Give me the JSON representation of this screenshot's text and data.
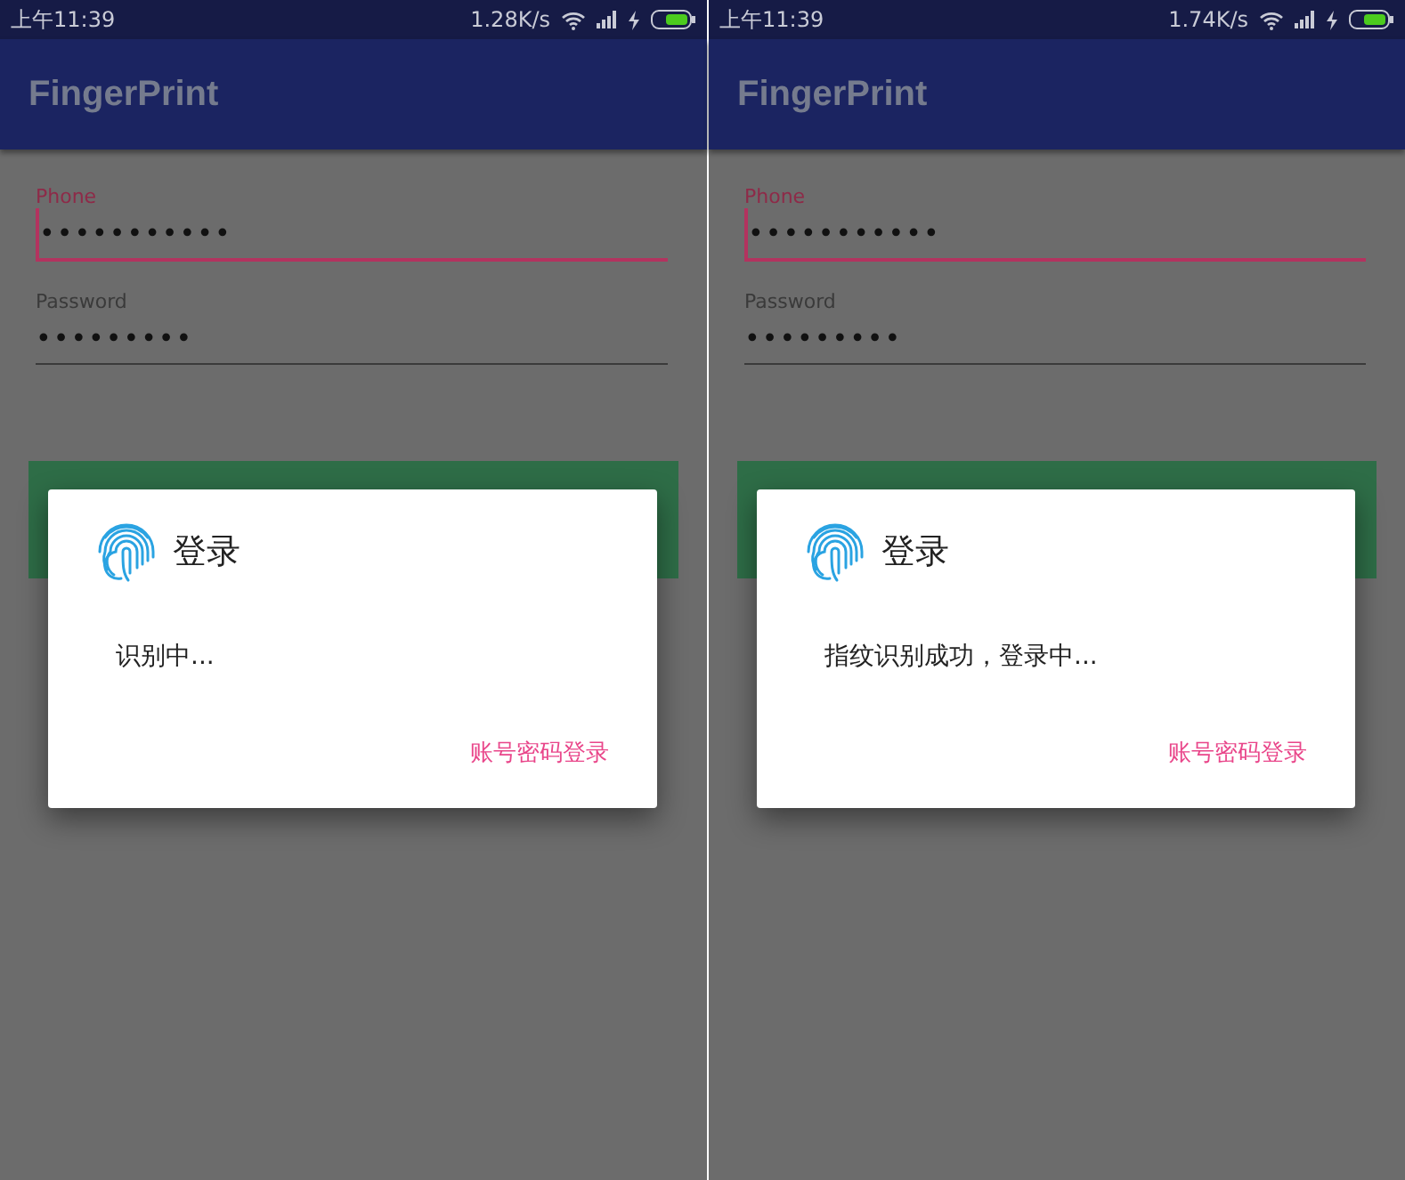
{
  "screens": [
    {
      "status_bar": {
        "time": "上午11:39",
        "speed": "1.28K/s"
      },
      "app_bar": {
        "title": "FingerPrint"
      },
      "fields": [
        {
          "label": "Phone",
          "value": "•••••••••••",
          "focused": true
        },
        {
          "label": "Password",
          "value": "•••••••••",
          "focused": false
        }
      ],
      "dialog": {
        "title": "登录",
        "message": "识别中...",
        "action": "账号密码登录"
      }
    },
    {
      "status_bar": {
        "time": "上午11:39",
        "speed": "1.74K/s"
      },
      "app_bar": {
        "title": "FingerPrint"
      },
      "fields": [
        {
          "label": "Phone",
          "value": "•••••••••••",
          "focused": true
        },
        {
          "label": "Password",
          "value": "•••••••••",
          "focused": false
        }
      ],
      "dialog": {
        "title": "登录",
        "message": "指纹识别成功，登录中...",
        "action": "账号密码登录"
      }
    }
  ]
}
